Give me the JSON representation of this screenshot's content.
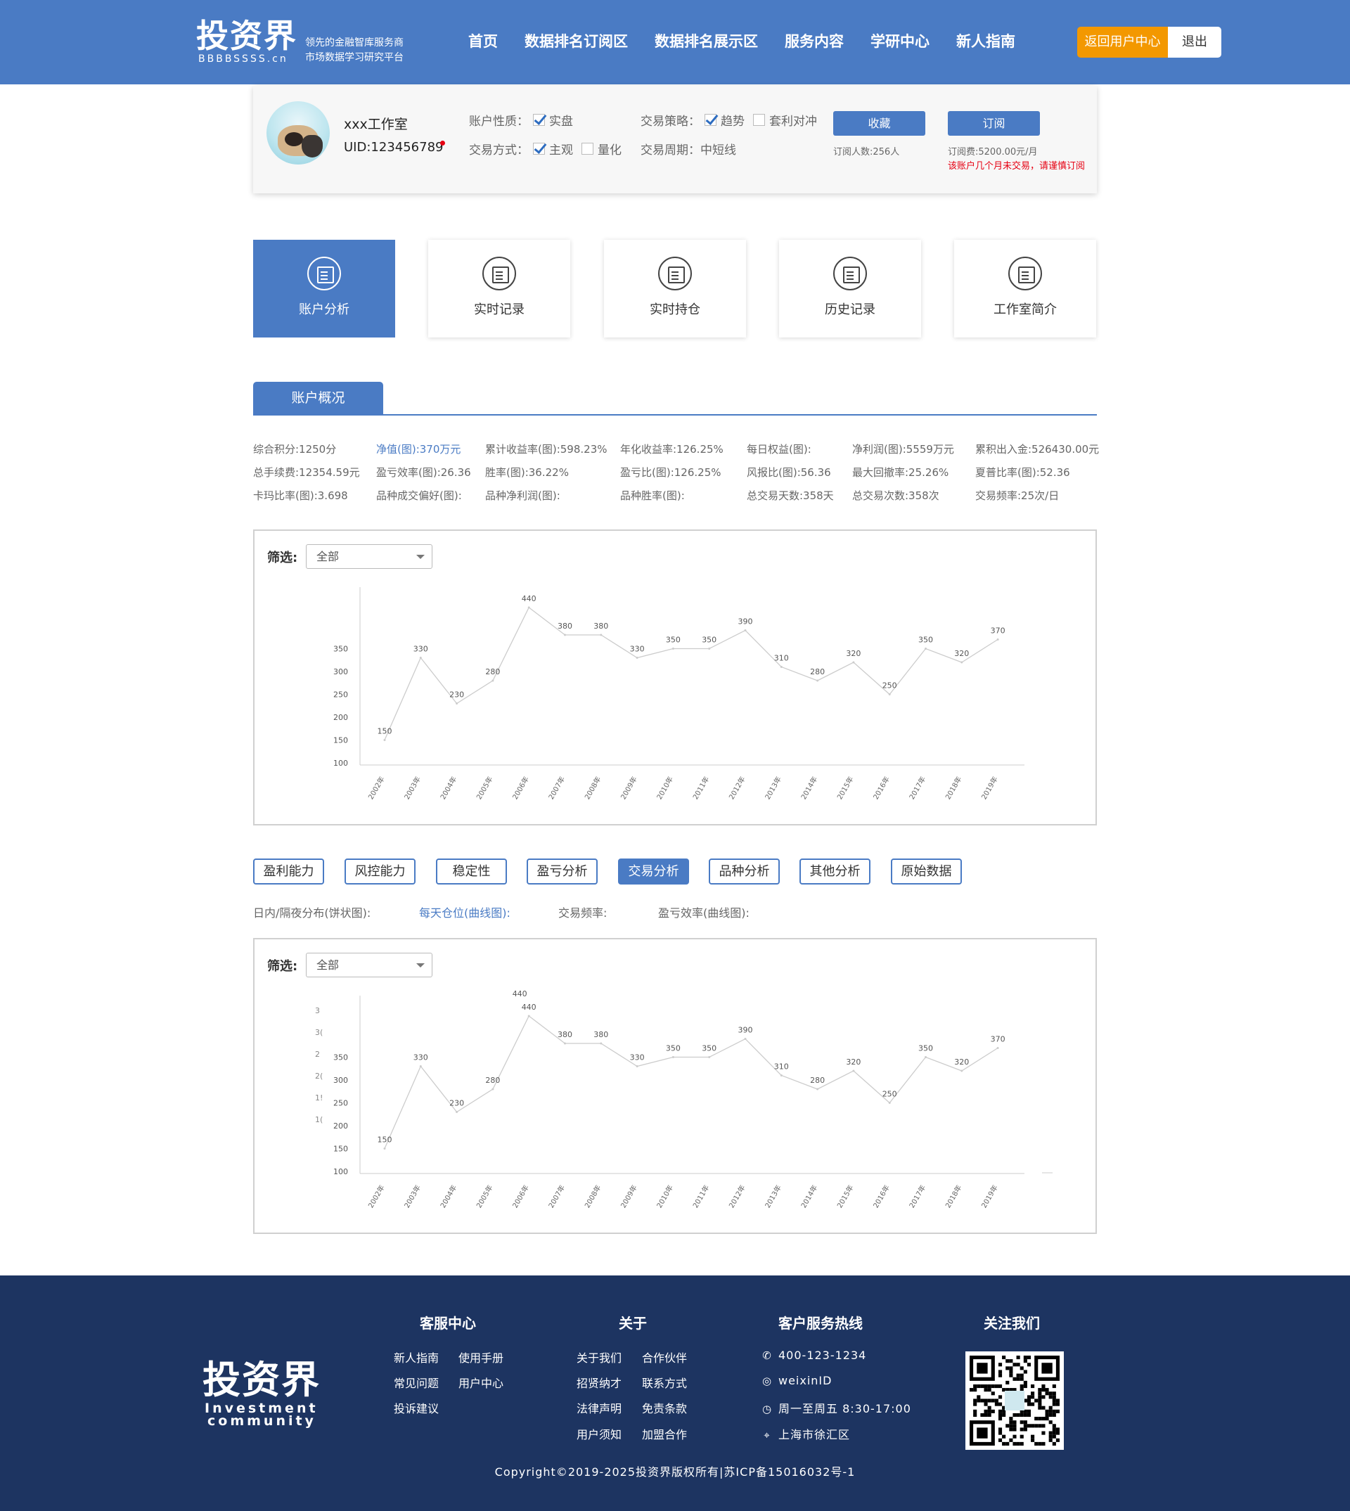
{
  "header": {
    "logo": "投资界",
    "logo_sub": "BBBBSSSS.cn",
    "tagline_1": "领先的金融智库服务商",
    "tagline_2": "市场数据学习研究平台",
    "nav": [
      "首页",
      "数据排名订阅区",
      "数据排名展示区",
      "服务内容",
      "学研中心",
      "新人指南"
    ],
    "btn_home": "返回用户中心",
    "btn_logout": "退出",
    "accent": "#4a7bc4",
    "orange": "#f39800"
  },
  "profile": {
    "name": "xxx工作室",
    "uid": "UID:123456789",
    "acct_type_label": "账户性质：",
    "acct_real": "实盘",
    "method_label": "交易方式：",
    "method_subjective": "主观",
    "method_quant": "量化",
    "strategy_label": "交易策略：",
    "strategy_trend": "趋势",
    "strategy_arb": "套利对冲",
    "period_label": "交易周期：",
    "period_value": "中短线",
    "btn_favorite": "收藏",
    "btn_subscribe": "订阅",
    "subscribers": "订阅人数:256人",
    "fee": "订阅费:5200.00元/月",
    "warning": "该账户几个月未交易，请谨慎订阅"
  },
  "tabs": [
    "账户分析",
    "实时记录",
    "实时持仓",
    "历史记录",
    "工作室简介"
  ],
  "section_title": "账户概况",
  "stats": [
    [
      "综合积分:1250分",
      "净值(图):370万元",
      "累计收益率(图):598.23%",
      "年化收益率:126.25%",
      "每日权益(图):",
      "净利润(图):5559万元",
      "累积出入金:526430.00元"
    ],
    [
      "总手续费:12354.59元",
      "盈亏效率(图):26.36",
      "胜率(图):36.22%",
      "盈亏比(图):126.25%",
      "风报比(图):56.36",
      "最大回撤率:25.26%",
      "夏普比率(图):52.36"
    ],
    [
      "卡玛比率(图):3.698",
      "品种成交偏好(图):",
      "品种净利润(图):",
      "品种胜率(图):",
      "总交易天数:358天",
      "总交易次数:358次",
      "交易频率:25次/日"
    ]
  ],
  "filter": {
    "label": "筛选:",
    "value": "全部"
  },
  "analysis_buttons": [
    "盈利能力",
    "风控能力",
    "稳定性",
    "盈亏分析",
    "交易分析",
    "品种分析",
    "其他分析",
    "原始数据"
  ],
  "analysis_links": [
    "日内/隔夜分布(饼状图):",
    "每天仓位(曲线图):",
    "交易频率:",
    "盈亏效率(曲线图):"
  ],
  "chart_data": [
    {
      "type": "line",
      "categories": [
        "2002年",
        "2003年",
        "2004年",
        "2005年",
        "2006年",
        "2007年",
        "2008年",
        "2009年",
        "2010年",
        "2011年",
        "2012年",
        "2013年",
        "2014年",
        "2015年",
        "2016年",
        "2017年",
        "2018年",
        "2019年"
      ],
      "values": [
        150,
        330,
        230,
        280,
        440,
        380,
        380,
        330,
        350,
        350,
        390,
        310,
        280,
        320,
        250,
        350,
        320,
        370
      ],
      "y_ticks": [
        100,
        150,
        200,
        250,
        300,
        350
      ],
      "ylim": [
        60,
        440
      ],
      "grid": false,
      "color": "#cccccc"
    },
    {
      "type": "line",
      "categories": [
        "2002年",
        "2003年",
        "2004年",
        "2005年",
        "2006年",
        "2007年",
        "2008年",
        "2009年",
        "2010年",
        "2011年",
        "2012年",
        "2013年",
        "2014年",
        "2015年",
        "2016年",
        "2017年",
        "2018年",
        "2019年"
      ],
      "values": [
        150,
        330,
        230,
        280,
        440,
        380,
        380,
        330,
        350,
        350,
        390,
        310,
        280,
        320,
        250,
        350,
        320,
        370
      ],
      "extra_label": "440",
      "ghost_ticks": [
        "3",
        "3(",
        "2",
        "2(",
        "1!",
        "1("
      ],
      "y_ticks": [
        100,
        150,
        200,
        250,
        300,
        350
      ],
      "ylim": [
        60,
        440
      ],
      "grid": false,
      "color": "#cccccc"
    }
  ],
  "footer": {
    "logo": "投资界",
    "logo_sub_1": "Investment",
    "logo_sub_2": "community",
    "col_service": "客服中心",
    "service_links": [
      "新人指南",
      "使用手册",
      "常见问题",
      "用户中心",
      "投诉建议"
    ],
    "col_about": "关于",
    "about_links": [
      "关于我们",
      "合作伙伴",
      "招贤纳才",
      "联系方式",
      "法律声明",
      "免责条款",
      "用户须知",
      "加盟合作"
    ],
    "col_hotline": "客户服务热线",
    "phone": "400-123-1234",
    "wechat": "weixinID",
    "hours": "周一至周五 8:30-17:00",
    "address": "上海市徐汇区",
    "col_follow": "关注我们",
    "copyright": "Copyright©2019-2025投资界版权所有|苏ICP备15016032号-1",
    "bg": "#1d3461"
  }
}
